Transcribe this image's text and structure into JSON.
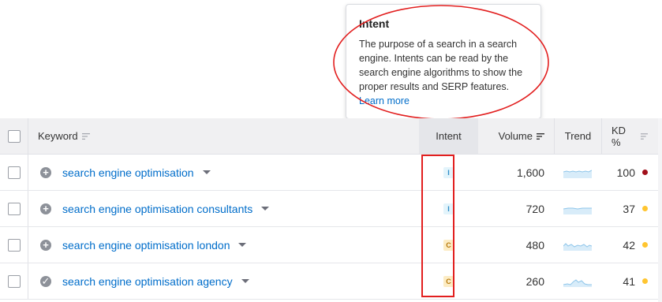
{
  "tooltip": {
    "title": "Intent",
    "body": "The purpose of a search in a search engine. Intents can be read by the search engine algorithms to show the proper results and SERP features.",
    "link": "Learn more"
  },
  "table": {
    "headers": {
      "keyword": "Keyword",
      "intent": "Intent",
      "volume": "Volume",
      "trend": "Trend",
      "kd": "KD %"
    },
    "rows": [
      {
        "keyword": "search engine optimisation",
        "status_icon": "plus-circle-icon",
        "intent": "I",
        "volume": "1,600",
        "kd": "100",
        "kd_color": "#a10f1a",
        "trend": "flat"
      },
      {
        "keyword": "search engine optimisation consultants",
        "status_icon": "plus-circle-icon",
        "intent": "I",
        "volume": "720",
        "kd": "37",
        "kd_color": "#ffc530",
        "trend": "flat"
      },
      {
        "keyword": "search engine optimisation london",
        "status_icon": "plus-circle-icon",
        "intent": "C",
        "volume": "480",
        "kd": "42",
        "kd_color": "#ffc530",
        "trend": "wavy"
      },
      {
        "keyword": "search engine optimisation agency",
        "status_icon": "check-circle-icon",
        "intent": "C",
        "volume": "260",
        "kd": "41",
        "kd_color": "#ffc530",
        "trend": "peak"
      }
    ]
  },
  "colors": {
    "link": "#006dca",
    "intent_informational_bg": "#e3f4fb",
    "intent_informational_fg": "#2d8cc8",
    "intent_commercial_bg": "#fcecc4",
    "intent_commercial_fg": "#b8790b",
    "highlight": "#e21f1f",
    "trend_line": "#8fc6ea"
  }
}
